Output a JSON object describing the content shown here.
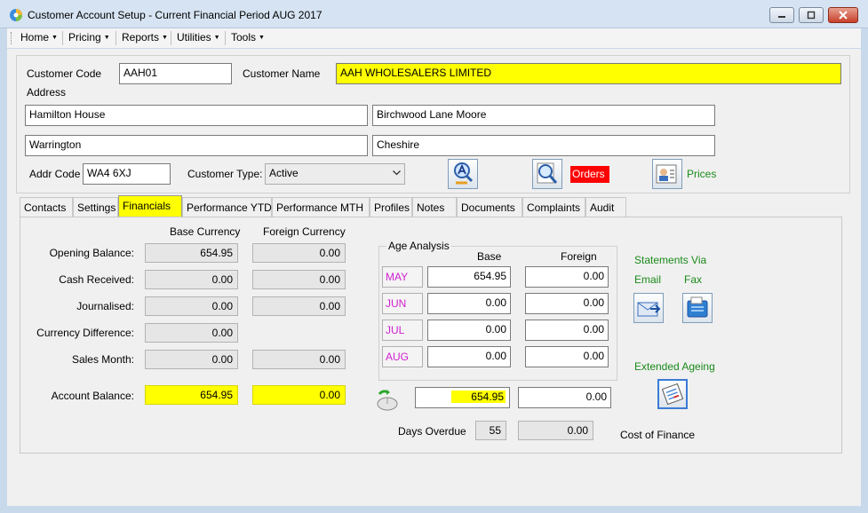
{
  "window": {
    "title": "Customer Account Setup - Current Financial Period AUG 2017"
  },
  "menu": [
    "Home",
    "Pricing",
    "Reports",
    "Utilities",
    "Tools"
  ],
  "customer": {
    "code_label": "Customer Code",
    "code": "AAH01",
    "name_label": "Customer Name",
    "name": "AAH  WHOLESALERS LIMITED",
    "address_label": "Address",
    "address1": "Hamilton House",
    "address2": "Birchwood Lane Moore",
    "address3": "Warrington",
    "address4": "Cheshire",
    "addr_code_label": "Addr Code",
    "addr_code": "WA4 6XJ",
    "type_label": "Customer Type:",
    "type": "Active",
    "orders_label": "Orders",
    "prices_label": "Prices"
  },
  "tabs": [
    "Contacts",
    "Settings",
    "Financials",
    "Performance YTD",
    "Performance MTH",
    "Profiles",
    "Notes",
    "Documents",
    "Complaints",
    "Audit"
  ],
  "active_tab": "Financials",
  "financials": {
    "base_header": "Base Currency",
    "foreign_header": "Foreign Currency",
    "rows": [
      {
        "label": "Opening Balance:",
        "base": "654.95",
        "foreign": "0.00"
      },
      {
        "label": "Cash Received:",
        "base": "0.00",
        "foreign": "0.00"
      },
      {
        "label": "Journalised:",
        "base": "0.00",
        "foreign": "0.00"
      },
      {
        "label": "Currency Difference:",
        "base": "0.00",
        "foreign": ""
      },
      {
        "label": "Sales Month:",
        "base": "0.00",
        "foreign": "0.00"
      }
    ],
    "account_balance_label": "Account Balance:",
    "account_balance_base": "654.95",
    "account_balance_foreign": "0.00"
  },
  "age_analysis": {
    "title": "Age Analysis",
    "base_header": "Base",
    "foreign_header": "Foreign",
    "rows": [
      {
        "month": "MAY",
        "base": "654.95",
        "foreign": "0.00"
      },
      {
        "month": "JUN",
        "base": "0.00",
        "foreign": "0.00"
      },
      {
        "month": "JUL",
        "base": "0.00",
        "foreign": "0.00"
      },
      {
        "month": "AUG",
        "base": "0.00",
        "foreign": "0.00"
      }
    ],
    "total_base": "654.95",
    "total_foreign": "0.00",
    "days_overdue_label": "Days Overdue",
    "days_overdue": "55",
    "cost_of_finance": "0.00",
    "cost_of_finance_label": "Cost of Finance"
  },
  "statements": {
    "title": "Statements Via",
    "email_label": "Email",
    "fax_label": "Fax",
    "extended_ageing_label": "Extended Ageing"
  },
  "colors": {
    "highlight": "#ffff00",
    "accent_green": "#1a8a1a",
    "month_magenta": "#d020d0",
    "orders_red": "#ff0000"
  }
}
